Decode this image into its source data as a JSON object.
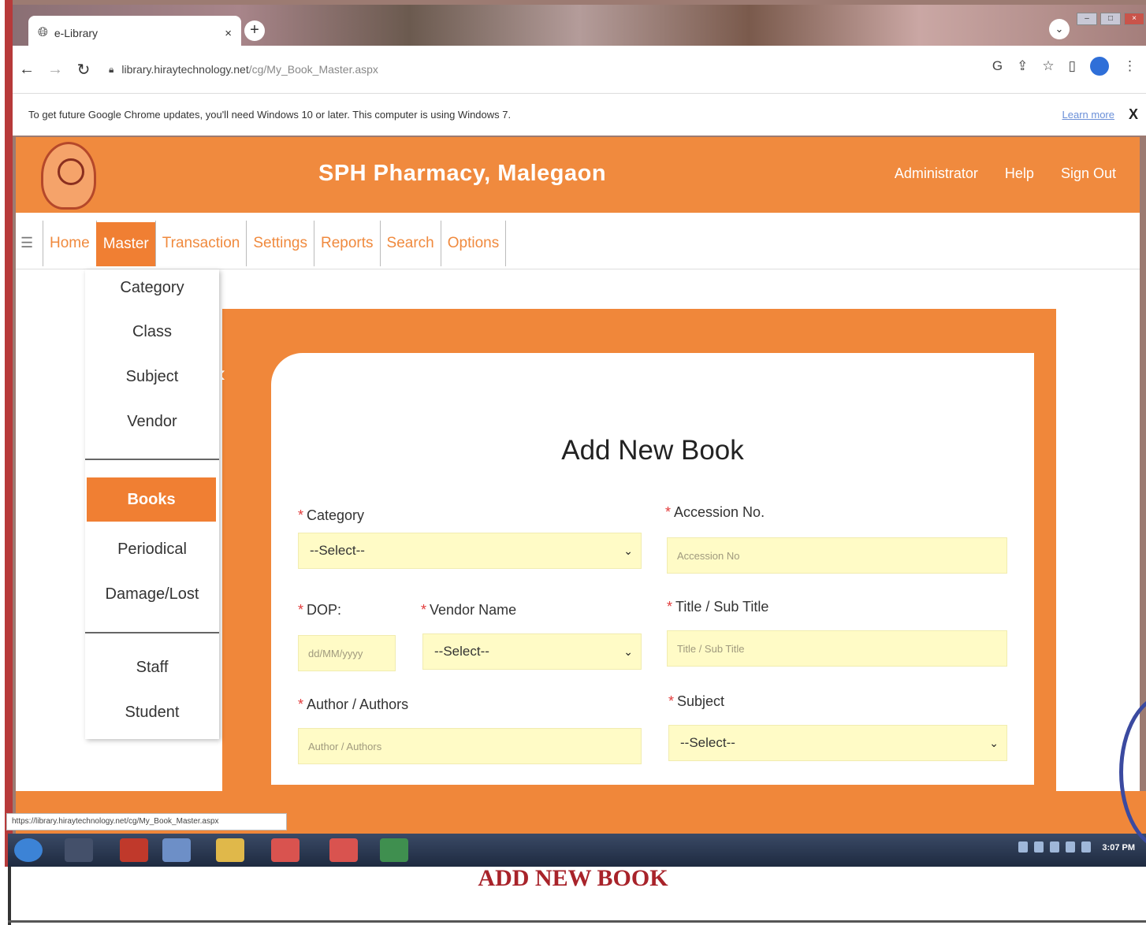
{
  "browser": {
    "tab_title": "e-Library",
    "tab_close": "×",
    "new_tab": "+",
    "url_host": "library.hiraytechnology.net",
    "url_path": "/cg/My_Book_Master.aspx",
    "info_bar_text": "To get future Google Chrome updates, you'll need Windows 10 or later. This computer is using Windows 7.",
    "info_bar_link": "Learn more",
    "info_bar_close": "X"
  },
  "header": {
    "site_title": "SPH Pharmacy, Malegaon",
    "links": [
      "Administrator",
      "Help",
      "Sign Out"
    ]
  },
  "nav": {
    "toggle": "☰",
    "items": [
      "Home",
      "Master",
      "Transaction",
      "Settings",
      "Reports",
      "Search",
      "Options"
    ],
    "active": "Master"
  },
  "submenu": {
    "group1": [
      "Category",
      "Class",
      "Subject",
      "Vendor"
    ],
    "group2": [
      "Books",
      "Periodical",
      "Damage/Lost"
    ],
    "group3": [
      "Staff",
      "Student"
    ],
    "active": "Books"
  },
  "form": {
    "title": "Add New Book",
    "category_label": "Category",
    "category_value": "--Select--",
    "accession_label": "Accession No.",
    "accession_placeholder": "Accession No",
    "dop_label": "DOP:",
    "dop_placeholder": "dd/MM/yyyy",
    "vendor_label": "Vendor Name",
    "vendor_value": "--Select--",
    "title_label": "Title / Sub Title",
    "title_placeholder": "Title / Sub Title",
    "author_label": "Author / Authors",
    "author_placeholder": "Author / Authors",
    "subject_label": "Subject",
    "subject_value": "--Select--",
    "required_mark": "*"
  },
  "status_bar": {
    "url": "https://library.hiraytechnology.net/cg/My_Book_Master.aspx"
  },
  "taskbar": {
    "clock": "3:07 PM"
  },
  "caption": "ADD NEW BOOK",
  "colors": {
    "brand_orange": "#f08a3e",
    "input_yellow": "#fffbc6",
    "caption_red": "#a8232a"
  },
  "icons": {
    "globe": "globe-icon",
    "back": "back-arrow-icon",
    "forward": "forward-arrow-icon",
    "reload": "reload-icon",
    "lock": "lock-icon",
    "star": "star-icon",
    "menu": "hamburger-menu-icon",
    "chevron": "chevron-down-icon"
  }
}
